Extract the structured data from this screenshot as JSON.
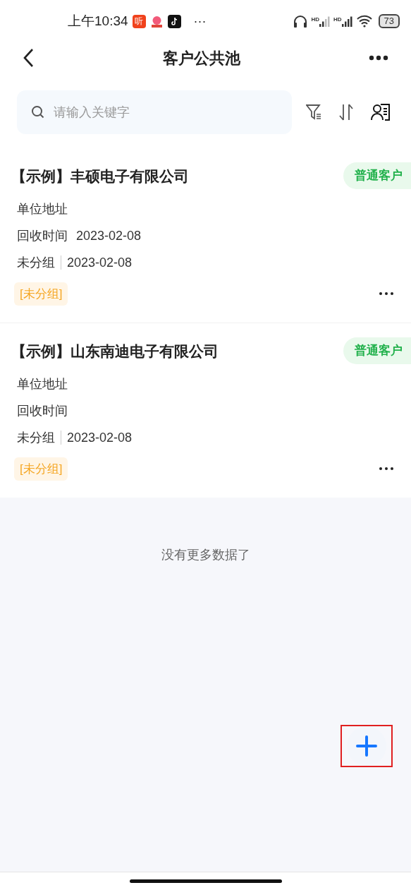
{
  "status_bar": {
    "time": "上午10:34",
    "app_icon_label": "听",
    "more": "···",
    "signal_labels": [
      "HD",
      "HD"
    ],
    "battery": "73"
  },
  "nav": {
    "title": "客户公共池"
  },
  "search": {
    "placeholder": "请输入关键字"
  },
  "customers": [
    {
      "name": "【示例】丰硕电子有限公司",
      "type_tag": "普通客户",
      "address_label": "单位地址",
      "recycle_label": "回收时间",
      "recycle_date": "2023-02-08",
      "group": "未分组",
      "group_date": "2023-02-08",
      "group_tag": "[未分组]"
    },
    {
      "name": "【示例】山东南迪电子有限公司",
      "type_tag": "普通客户",
      "address_label": "单位地址",
      "recycle_label": "回收时间",
      "group": "未分组",
      "group_date": "2023-02-08",
      "group_tag": "[未分组]"
    }
  ],
  "footer": "没有更多数据了"
}
